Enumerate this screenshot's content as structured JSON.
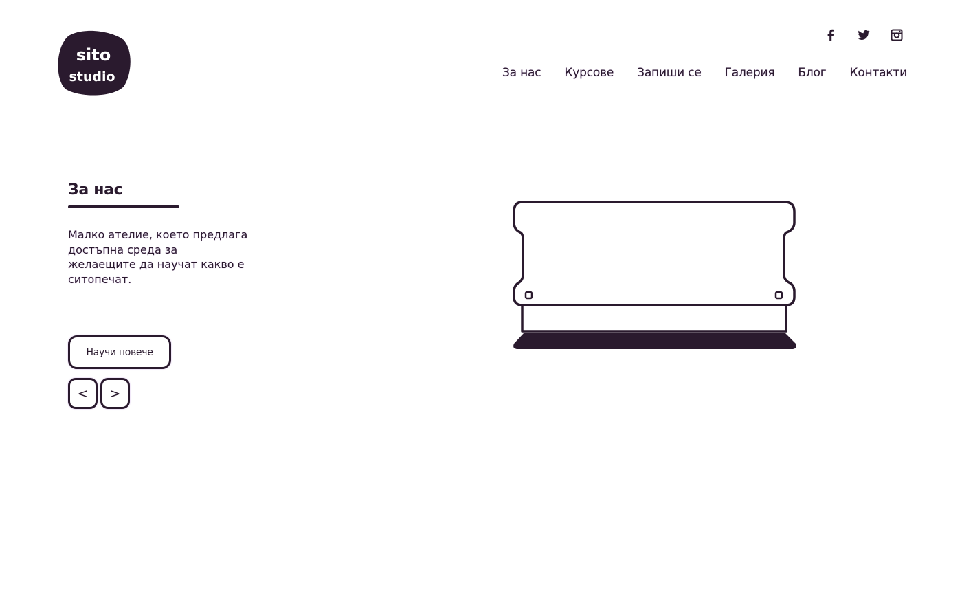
{
  "logo": {
    "line1": "sito",
    "line2": "studio",
    "icon": "sito-studio-logo"
  },
  "social": [
    {
      "name": "facebook",
      "icon": "facebook-icon"
    },
    {
      "name": "twitter",
      "icon": "twitter-icon"
    },
    {
      "name": "instagram",
      "icon": "instagram-icon"
    }
  ],
  "nav": {
    "items": [
      {
        "label": "За нас"
      },
      {
        "label": "Курсове"
      },
      {
        "label": "Запиши се"
      },
      {
        "label": "Галерия"
      },
      {
        "label": "Блог"
      },
      {
        "label": "Контакти"
      }
    ]
  },
  "about": {
    "title": "За нас",
    "text": "Малко ателие, което предлага достъпна среда за желаещите да научат какво е ситопечат.",
    "button_label": "Научи повече",
    "prev_label": "<",
    "next_label": ">"
  },
  "illustration": {
    "icon": "squeegee-illustration"
  },
  "colors": {
    "ink": "#2a1a2e",
    "glow": "#9650c8",
    "background": "#ffffff"
  }
}
